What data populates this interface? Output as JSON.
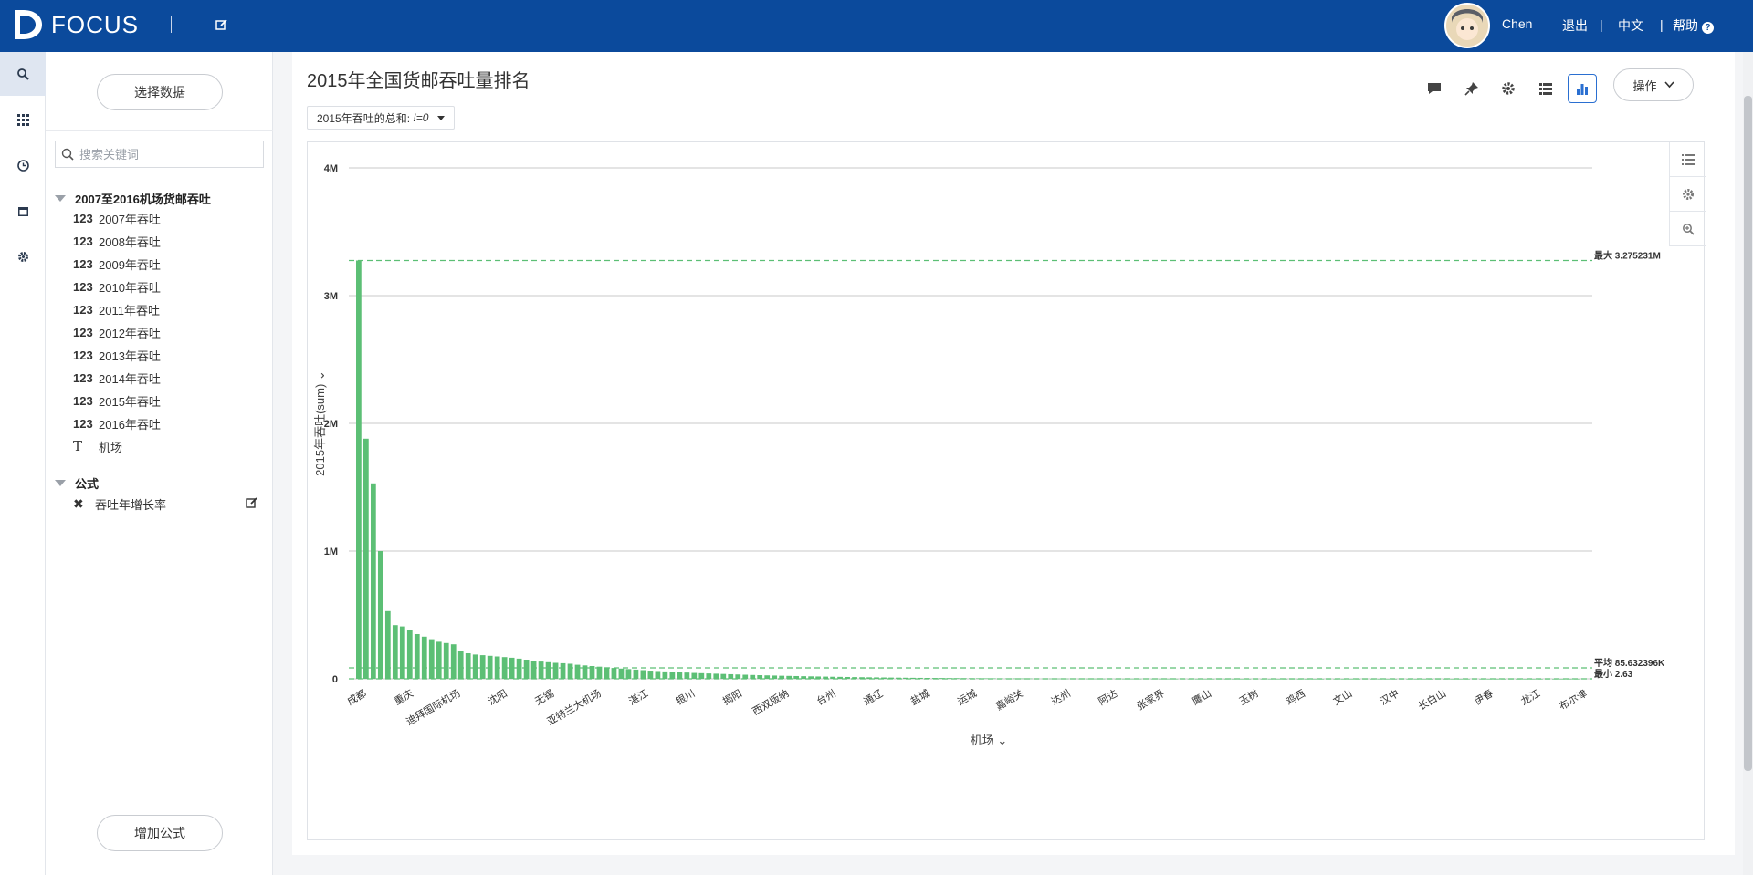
{
  "app": {
    "brand": "FOCUS"
  },
  "header": {
    "user_name": "Chen",
    "logout": "退出",
    "language": "中文",
    "help": "帮助"
  },
  "rail": {
    "items": [
      "search-icon",
      "grid-icon",
      "clock-icon",
      "calendar-icon",
      "gear-icon"
    ]
  },
  "panel": {
    "select_data_label": "选择数据",
    "search_placeholder": "搜索关键词",
    "table_name": "2007至2016机场货邮吞吐",
    "fields": [
      {
        "type": "123",
        "name": "2007年吞吐"
      },
      {
        "type": "123",
        "name": "2008年吞吐"
      },
      {
        "type": "123",
        "name": "2009年吞吐"
      },
      {
        "type": "123",
        "name": "2010年吞吐"
      },
      {
        "type": "123",
        "name": "2011年吞吐"
      },
      {
        "type": "123",
        "name": "2012年吞吐"
      },
      {
        "type": "123",
        "name": "2013年吞吐"
      },
      {
        "type": "123",
        "name": "2014年吞吐"
      },
      {
        "type": "123",
        "name": "2015年吞吐"
      },
      {
        "type": "123",
        "name": "2016年吞吐"
      },
      {
        "type": "T",
        "name": "机场"
      }
    ],
    "formula_group": "公式",
    "formulas": [
      {
        "name": "吞吐年增长率"
      }
    ],
    "add_formula_label": "增加公式"
  },
  "main": {
    "title": "2015年全国货邮吞吐量排名",
    "filter_label": "2015年吞吐的总和:",
    "filter_value": "!=0",
    "ops_label": "操作"
  },
  "colors": {
    "brand_bar": "#0b4a9c",
    "bar": "#5cbf75",
    "ref_line": "#5cbf75",
    "active_tool": "#2a6fd1"
  },
  "chart_data": {
    "type": "bar",
    "xlabel": "机场",
    "ylabel": "2015年吞吐(sum)",
    "ylim": [
      0,
      4000000
    ],
    "y_ticks": [
      "0",
      "1M",
      "2M",
      "3M",
      "4M"
    ],
    "x_tick_labels": [
      "成都",
      "重庆",
      "迪拜国际机场",
      "沈阳",
      "无锡",
      "亚特兰大机场",
      "湛江",
      "银川",
      "揭阳",
      "西双版纳",
      "台州",
      "通辽",
      "盐城",
      "运城",
      "嘉峪关",
      "达州",
      "阿达",
      "张家界",
      "鹰山",
      "玉树",
      "鸡西",
      "文山",
      "汉中",
      "长白山",
      "伊春",
      "龙江",
      "布尔津"
    ],
    "ref_lines": [
      {
        "label": "最大 3.275231M",
        "value": 3275231
      },
      {
        "label": "平均 85.632396K",
        "value": 85632
      },
      {
        "label": "最小 2.63",
        "value": 2.63
      }
    ],
    "values": [
      3275231,
      1880000,
      1530000,
      1000000,
      530000,
      420000,
      410000,
      380000,
      350000,
      330000,
      310000,
      290000,
      280000,
      270000,
      220000,
      200000,
      190000,
      185000,
      180000,
      175000,
      170000,
      165000,
      158000,
      150000,
      140000,
      135000,
      130000,
      125000,
      122000,
      118000,
      110000,
      105000,
      100000,
      95000,
      90000,
      85000,
      80000,
      76000,
      72000,
      68000,
      64000,
      61000,
      58000,
      55000,
      52000,
      49000,
      46000,
      44000,
      42000,
      40000,
      38000,
      36000,
      34000,
      32000,
      30000,
      28500,
      27000,
      25500,
      24000,
      22800,
      21600,
      20400,
      19300,
      18200,
      17200,
      16200,
      15300,
      14400,
      13500,
      12700,
      11900,
      11200,
      10500,
      9800,
      9200,
      8600,
      8000,
      7500,
      7000,
      6500,
      6100,
      5700,
      5300,
      4900,
      4600,
      4300,
      4000,
      3700,
      3400,
      3200,
      3000,
      2800,
      2600,
      2400,
      2200,
      2050,
      1900,
      1750,
      1620,
      1500,
      1390,
      1280,
      1180,
      1090,
      1000,
      920,
      850,
      780,
      720,
      660,
      610,
      560,
      515,
      475,
      435,
      400,
      368,
      338,
      310,
      285,
      262,
      240,
      220,
      202,
      185,
      170,
      156,
      143,
      131,
      120,
      110,
      100,
      92,
      84,
      77,
      70,
      64,
      58,
      53,
      48,
      44,
      40,
      36,
      33,
      30,
      27,
      24,
      22,
      20,
      18,
      16,
      14,
      12.5,
      11,
      10,
      9,
      8,
      7,
      6.3,
      5.6,
      5,
      4.4,
      3.9,
      3.4,
      3,
      2.8,
      2.7,
      2.63
    ]
  }
}
